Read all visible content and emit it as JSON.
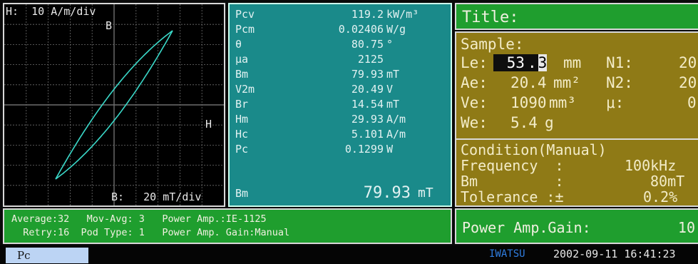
{
  "plot": {
    "h_scale": "H:  10 A/m/div",
    "b_scale": "B:   20 mT/div",
    "b_axis": "B",
    "h_axis": "H"
  },
  "measurements": [
    {
      "name": "Pcv",
      "value": "119.2",
      "unit": "kW/m³"
    },
    {
      "name": "Pcm",
      "value": "0.02406",
      "unit": "W/g"
    },
    {
      "name": "θ",
      "value": "80.75",
      "unit": "°"
    },
    {
      "name": "μa",
      "value": "2125",
      "unit": ""
    },
    {
      "name": "Bm",
      "value": "79.93",
      "unit": "mT"
    },
    {
      "name": "V2m",
      "value": "20.49",
      "unit": "V"
    },
    {
      "name": "Br",
      "value": "14.54",
      "unit": "mT"
    },
    {
      "name": "Hm",
      "value": "29.93",
      "unit": "A/m"
    },
    {
      "name": "Hc",
      "value": "5.101",
      "unit": "A/m"
    },
    {
      "name": "Pc",
      "value": "0.1299",
      "unit": "W"
    }
  ],
  "measurement_footer": {
    "name": "Bm",
    "value": "79.93",
    "unit": "mT"
  },
  "title_label": "Title:",
  "sample": {
    "heading": "Sample:",
    "le_label": "Le:",
    "le_int": "53",
    "le_dot": ".",
    "le_dec": "3",
    "le_unit": "mm",
    "n1_label": "N1:",
    "n1_value": "20",
    "ae_label": "Ae:",
    "ae_value": "20.4",
    "ae_unit": "mm²",
    "n2_label": "N2:",
    "n2_value": "20",
    "ve_label": "Ve:",
    "ve_value": "1090",
    "ve_unit": "mm³",
    "mu_label": "μ:",
    "mu_value": "0",
    "we_label": "We:",
    "we_value": "5.4",
    "we_unit": "g"
  },
  "condition": {
    "heading": "Condition(Manual)",
    "freq_label": "Frequency  :",
    "freq_value": "100kHz",
    "bm_label": "Bm         :",
    "bm_value": "80mT",
    "tol_label": "Tolerance :±",
    "tol_value": "0.2%"
  },
  "status": {
    "line1": "Average:32   Mov-Avg: 3   Power Amp.:IE-1125",
    "line2": "  Retry:16  Pod Type: 1   Power Amp. Gain:Manual"
  },
  "gain": {
    "label": "Power Amp.Gain:",
    "value": "10"
  },
  "footer": {
    "active_tab": "Pc",
    "brand": "IWATSU",
    "datetime": "2002-09-11 16:41:23"
  },
  "colors": {
    "trace": "#3ad8c8",
    "grid": "#6e6e6e",
    "plot_bg": "#000000",
    "meas_bg": "#1a8a8a",
    "sample_bg": "#8f7a16",
    "status_bg": "#1f9e2e"
  }
}
